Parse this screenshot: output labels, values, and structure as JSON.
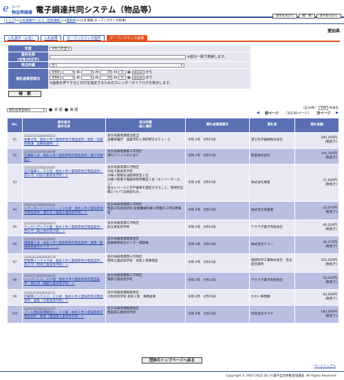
{
  "header": {
    "logo_top": "あいち",
    "logo_bottom": "物品等調達",
    "title": "電子調達共同システム（物品等）",
    "buttons": [
      "文字を大きく",
      "標　準",
      "文字を小さく"
    ]
  },
  "breadcrumb": [
    "トップ",
    "入札情報サービス（団体選択）",
    "愛知県",
    "入札情報:オープンカウンタ結果"
  ],
  "prefecture": "愛知県",
  "tabs": [
    "入札案件（公告）",
    "入札結果",
    "オープンカウンタ案件",
    "オープンカウンタ結果"
  ],
  "form": {
    "year_label": "年度",
    "year_value": "令和 4年度",
    "name_label": "案件名称",
    "name_label2": "(全角30文字)",
    "name_hint": "※部分一致で検索します。",
    "org_label": "発注所属",
    "org_value": "全て",
    "date_label": "開札結果登録日",
    "from": {
      "era": "令和",
      "y": "4",
      "m": "4",
      "d": "19",
      "day": "火",
      "clear": "クリア",
      "suffix": "から"
    },
    "to": {
      "era": "令和",
      "y": "4",
      "m": "4",
      "d": "19",
      "day": "火",
      "clear": "クリア",
      "suffix": "まで"
    },
    "cal_note": "※画像を押下すると日付を指定するためのカレンダーダイアログを表示します。",
    "search": "検　索"
  },
  "list_controls": {
    "sort_value": "開札結果登録日",
    "asc": "昇 順",
    "desc": "降 順",
    "count": "（全30件）",
    "page_size": "10",
    "unit": "件表示",
    "prev": "前ページ",
    "page": "（10/30ページ）",
    "next": "次ページ"
  },
  "table": {
    "headers": [
      "No.",
      "案件番号\n案件名称",
      "発注所属\n納入場所",
      "開札結果登録日",
      "落札者",
      "落札金額"
    ],
    "rows": [
      {
        "no": "91",
        "id": "220410230000036122",
        "name": "本事４台　始め１件＜愛知県地方物品案件：尾張（北部財務課　設備保護所）＞",
        "org": "会計局調達課発注担当\n設備保護所　設置市町ヶ湊町野方８０１－２",
        "date": "令和 4年　4月19日",
        "winner": "富士科学器械株式会社",
        "amount": "480,000円",
        "tax": "(税抜き)"
      },
      {
        "no": "92",
        "id": "220410230000036099",
        "name": "作業服１式　始め１件＜愛知県地方物品案件：東三河地区＞",
        "org": "会計局調達課東三河地区\n添付ファイルのとおり",
        "date": "令和 4年　4月19日",
        "winner": "原田株式会社",
        "amount": "345,100円",
        "tax": "(税抜き)"
      },
      {
        "no": "93",
        "id": "220410230000036087",
        "name": "石戸書庫２，００台　始め１件＜愛知県地方物品案件：西三河（刈谷工業高等学校）＞",
        "org": "会計局調達課三河地区\n刈谷工業高等学校\n分棟１階電気油脂保管室１台\n分棟３階電子機器保管準備室１台（エレベーターなし）\n組立レベールと打戸書庫を連結させること。整頓完全典については納品のみ。",
        "date": "令和 4年　4月19日",
        "winner": "株式会社惠夏",
        "amount": "47,600円",
        "tax": "(税抜き)"
      },
      {
        "no": "94",
        "id": "220410230000036001",
        "name": "トナーカートリッジ１，１００本　始め１件＜愛知県地方物品案件：西三河（豊田工業高等学校）＞",
        "org": "会計局調達課西三河地区\n豊田工科高等学校 産業機械科棟３階電子工学科準備室",
        "date": "令和 4年　4月19日",
        "winner": "株式会社渡邊寛",
        "amount": "43,070円",
        "tax": "(税抜き)"
      },
      {
        "no": "95",
        "id": "220410230000036073",
        "name": "ドッキングハブ４個　始め１件＜愛知県地方物品案件：西三河（知立東高等学校）＞",
        "org": "会計局調達課三河地区\n知立東高等学校",
        "date": "令和 4年　4月19日",
        "winner": "テクラ子電子有限会社",
        "amount": "40,200円",
        "tax": "(税抜き)"
      },
      {
        "no": "96",
        "id": "220410230000036061",
        "name": "課題機２台　始め１件＜愛知県地方物品案件：尾張（医療療育総合センター）＞",
        "org": "会計局調達課尾張地区\n医療療育総合センター相談棟",
        "date": "令和 4年　4月19日",
        "winner": "株式会社ヤコー",
        "amount": "46,472円",
        "tax": "(税抜き)"
      },
      {
        "no": "97",
        "id": "220410230000036739",
        "name": "印刷用インク４０本　始め１件＜愛知県地方物品案件：西三河（岡崎工業高等学校）＞",
        "org": "会計局調達課西三河地区\n岡崎工業高等学校　本館１階事務室",
        "date": "令和 4年　4月19日",
        "winner": "理想科学工業株式会社　名古屋営業所",
        "amount": "255,000円",
        "tax": "(税抜き)"
      },
      {
        "no": "98",
        "id": "220415230000036463",
        "name": "ニッパー１２，００個　始め４件＜愛知県地方物品案件：東三河（蒲郡工業高等学校）＞",
        "org": "会計局調達課東三河地区\n蒲郡工業高等学校",
        "date": "令和 4年　4月19日",
        "winner": "テクラ子電子有限会社",
        "amount": "43,344円",
        "tax": "(税抜き)"
      },
      {
        "no": "99",
        "id": "220410230000036121",
        "name": "印刷用インク１０，００本　始め２件＜愛知県地方物品案件：尾張（小牧高等学校）＞",
        "org": "会計局調達課尾張地区\n小牧高等学校 本館１階　事務倉庫",
        "date": "令和 4年　4月19日",
        "winner": "かわい事務機",
        "amount": "93,000円",
        "tax": "(税抜き)"
      },
      {
        "no": "100",
        "id": "220410230000036707",
        "name": "ブール用殺菌薄膜剤５，００箱　始め１件＜愛知県地方物品案件：尾張（豊田東工業高等学校）＞",
        "org": "会計局調達課尾張地区\n豊田東工業高等学校",
        "date": "令和 4年　4月19日",
        "winner": "有限会社ヤマヤ",
        "amount": "184,000円",
        "tax": "(税抜き)"
      }
    ]
  },
  "back_button": "団体のトップページへ戻る",
  "page_top": "ページトップへ",
  "footer": "Copyright © 2007-2022 あいち電子自治体推進協議会. All Rights Reserved."
}
